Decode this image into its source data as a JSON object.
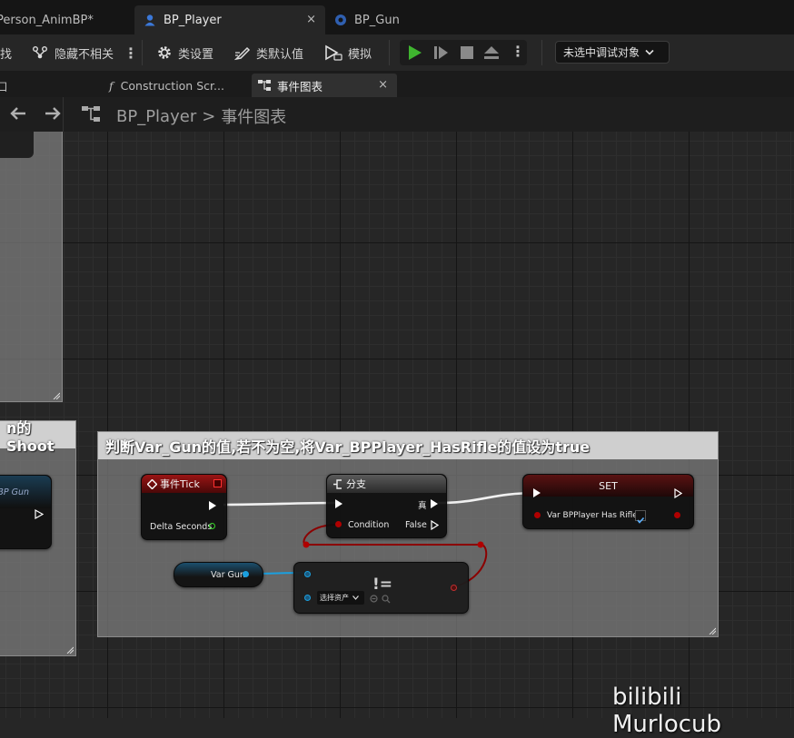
{
  "tabs": [
    {
      "label": "Person_AnimBP*"
    },
    {
      "label": "BP_Player",
      "close": "×"
    },
    {
      "label": "BP_Gun"
    }
  ],
  "toolbar": {
    "find": "找",
    "hide_unrelated": "隐藏不相关",
    "class_settings": "类设置",
    "class_defaults": "类默认值",
    "simulate": "模拟",
    "debug_target": "未选中调试对象"
  },
  "subtabs": [
    {
      "label": "口"
    },
    {
      "label": "Construction Scr...",
      "icon": "function-icon"
    },
    {
      "label": "事件图表",
      "close": "×"
    }
  ],
  "breadcrumb": {
    "root": "BP_Player",
    "separator": ">",
    "current": "事件图表"
  },
  "comments": {
    "left_title": "n的Shoot",
    "main_title": "判断Var_Gun的值,若不为空,将Var_BPPlayer_HasRifle的值设为true"
  },
  "nodes": {
    "left_node_label": "BP Gun",
    "event_tick": {
      "title": "事件Tick",
      "pin": "Delta Seconds"
    },
    "branch": {
      "title": "分支",
      "true_label": "真",
      "condition": "Condition",
      "false_label": "False"
    },
    "set": {
      "title": "SET",
      "var": "Var BPPlayer Has Rifle",
      "checked": true
    },
    "var_gun": {
      "label": "Var Gun"
    },
    "not_equal": {
      "symbol": "!=",
      "asset_select": "选择资产"
    }
  },
  "colors": {
    "exec": "#ffffff",
    "bool": "#8b0000",
    "object": "#1aa0e0",
    "event_header": "#8a1010",
    "float": "#39d62b"
  },
  "watermark": "bilibili Murlocub"
}
